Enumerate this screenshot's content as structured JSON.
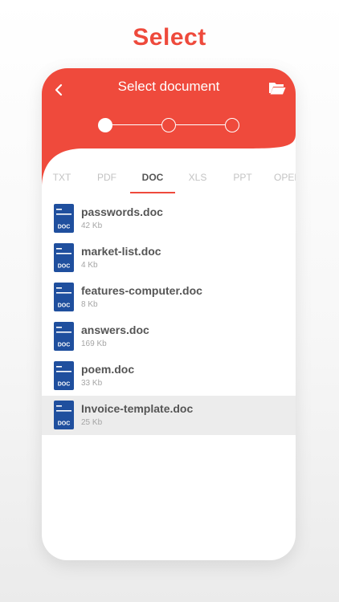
{
  "promo": {
    "title": "Select"
  },
  "header": {
    "title": "Select document"
  },
  "stepper": {
    "steps": 3,
    "current": 1
  },
  "tabs": [
    {
      "label": "TXT",
      "active": false
    },
    {
      "label": "PDF",
      "active": false
    },
    {
      "label": "DOC",
      "active": true
    },
    {
      "label": "XLS",
      "active": false
    },
    {
      "label": "PPT",
      "active": false
    },
    {
      "label": "OPEN",
      "active": false
    }
  ],
  "files": [
    {
      "name": "passwords.doc",
      "size": "42 Kb",
      "badge": "DOC",
      "selected": false
    },
    {
      "name": "market-list.doc",
      "size": "4 Kb",
      "badge": "DOC",
      "selected": false
    },
    {
      "name": "features-computer.doc",
      "size": "8 Kb",
      "badge": "DOC",
      "selected": false
    },
    {
      "name": "answers.doc",
      "size": "169 Kb",
      "badge": "DOC",
      "selected": false
    },
    {
      "name": "poem.doc",
      "size": "33 Kb",
      "badge": "DOC",
      "selected": false
    },
    {
      "name": "Invoice-template.doc",
      "size": "25 Kb",
      "badge": "DOC",
      "selected": true
    }
  ],
  "icons": {
    "back": "chevron-left-icon",
    "folder": "folder-open-icon",
    "document": "doc-file-icon"
  },
  "colors": {
    "accent": "#ee4a3c",
    "header": "#ef4a3c",
    "doc_icon": "#1f4f9e",
    "text": "#555555",
    "muted": "#a5a5a5",
    "selected_row": "#ececec"
  }
}
